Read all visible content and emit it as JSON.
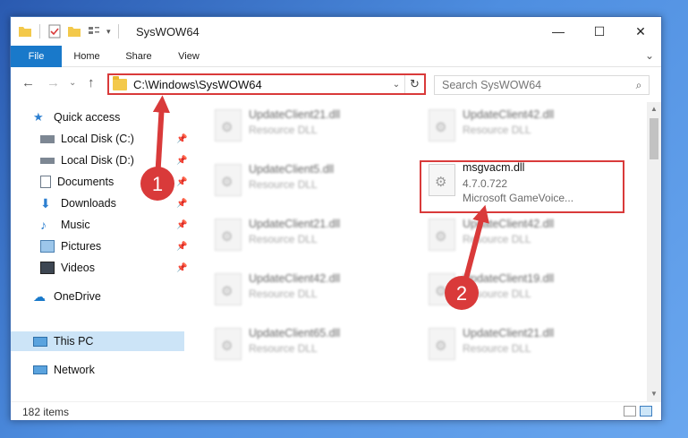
{
  "window": {
    "title": "SysWOW64"
  },
  "ribbon": {
    "tabs": [
      "File",
      "Home",
      "Share",
      "View"
    ]
  },
  "address": {
    "path": "C:\\Windows\\SysWOW64"
  },
  "search": {
    "placeholder": "Search SysWOW64"
  },
  "nav": {
    "quick_access": "Quick access",
    "items": [
      "Local Disk (C:)",
      "Local Disk (D:)",
      "Documents",
      "Downloads",
      "Music",
      "Pictures",
      "Videos"
    ],
    "onedrive": "OneDrive",
    "this_pc": "This PC",
    "network": "Network"
  },
  "files": [
    {
      "name": "UpdateClient21.dll",
      "desc": "Resource DLL"
    },
    {
      "name": "UpdateClient42.dll",
      "desc": "Resource DLL"
    },
    {
      "name": "UpdateClient5.dll",
      "desc": "Resource DLL"
    },
    {
      "name": "msgvacm.dll",
      "version": "4.7.0.722",
      "desc": "Microsoft GameVoice..."
    },
    {
      "name": "UpdateClient21.dll",
      "desc": "Resource DLL"
    },
    {
      "name": "UpdateClient42.dll",
      "desc": "Resource DLL"
    },
    {
      "name": "UpdateClient42.dll",
      "desc": "Resource DLL"
    },
    {
      "name": "UpdateClient19.dll",
      "desc": "Resource DLL"
    },
    {
      "name": "UpdateClient65.dll",
      "desc": "Resource DLL"
    },
    {
      "name": "UpdateClient21.dll",
      "desc": "Resource DLL"
    }
  ],
  "status": {
    "item_count": "182 items"
  },
  "annotations": {
    "step1": "1",
    "step2": "2"
  },
  "colors": {
    "accent": "#1979ca",
    "highlight": "#d93a3a",
    "selected_nav": "#cce4f7"
  }
}
